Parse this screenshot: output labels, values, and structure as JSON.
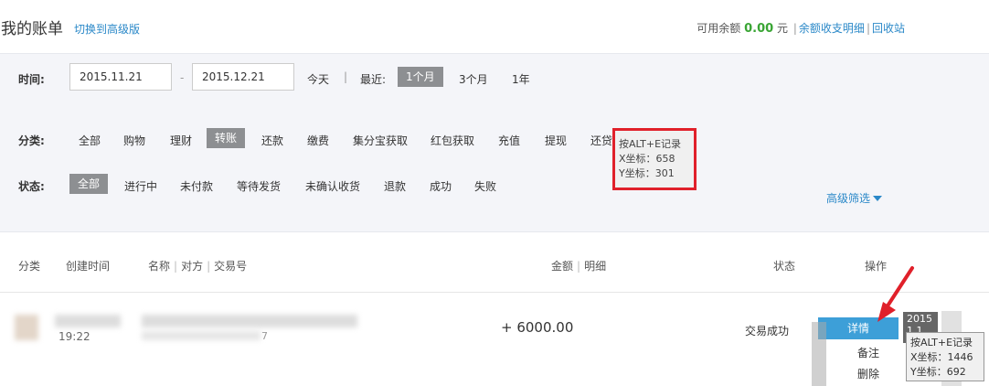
{
  "header": {
    "title": "我的账单",
    "switch_link": "切换到高级版",
    "balance_label": "可用余额",
    "balance_amount": "0.00",
    "balance_unit": "元",
    "link_detail": "余额收支明细",
    "link_recycle": "回收站",
    "separator": "|"
  },
  "time_filter": {
    "label": "时间:",
    "start_date": "2015.11.21",
    "dash": "-",
    "end_date": "2015.12.21",
    "today": "今天",
    "separator": "|",
    "recent_label": "最近:",
    "ranges": [
      "1个月",
      "3个月",
      "1年"
    ],
    "selected_range": "1个月"
  },
  "category_filter": {
    "label": "分类:",
    "items": [
      "全部",
      "购物",
      "理财",
      "转账",
      "还款",
      "缴费",
      "集分宝获取",
      "红包获取",
      "充值",
      "提现",
      "还贷"
    ],
    "selected": "转账"
  },
  "status_filter": {
    "label": "状态:",
    "items": [
      "全部",
      "进行中",
      "未付款",
      "等待发货",
      "未确认收货",
      "退款",
      "成功",
      "失败"
    ],
    "selected": "全部"
  },
  "advanced_filter": "高级筛选",
  "coord_tooltip": {
    "line1": "按ALT+E记录",
    "line2": "X坐标：658",
    "line3": "Y坐标：301",
    "border_color": "#e0202a"
  },
  "table": {
    "headers": {
      "category": "分类",
      "created": "创建时间",
      "name": "名称",
      "counterpart": "对方",
      "trade_no": "交易号",
      "amount": "金额",
      "detail": "明细",
      "status": "状态",
      "action": "操作",
      "bar": "|"
    },
    "rows": [
      {
        "time": "19:22",
        "trade_no_tail": "7",
        "amount": "+ 6000.00",
        "status": "交易成功",
        "detail_btn": "详情",
        "note_link": "备注",
        "delete_link": "删除"
      }
    ]
  },
  "overlay": {
    "year_badge": "2015",
    "year_badge_2": "1 1",
    "tip_line1": "按ALT+E记录",
    "tip_line2": "X坐标：1446",
    "tip_line3": "Y坐标：692"
  },
  "colors": {
    "accent_link": "#2a88c8",
    "balance_green": "#3aa535",
    "chip_gray": "#8d8f92",
    "button_blue": "#3d9fd8",
    "arrow_red": "#e0202a"
  },
  "icons": [
    "dropdown-triangle-icon",
    "red-arrow-pointer-icon"
  ]
}
